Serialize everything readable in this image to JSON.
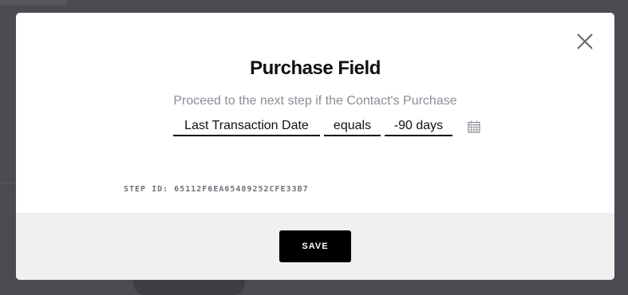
{
  "modal": {
    "title": "Purchase Field",
    "subtitle": "Proceed to the next step if the Contact's Purchase",
    "close_icon": "close-icon",
    "fields": {
      "property": "Last Transaction Date",
      "operator": "equals",
      "value": "-90 days"
    },
    "calendar_icon": "calendar-icon",
    "step_id": "STEP ID: 65112F6EA65489252CFE33B7",
    "save_label": "SAVE"
  },
  "colors": {
    "overlay": "#4a4c52",
    "button": "#000000",
    "footer": "#f0f0f0",
    "subtitle": "#8a8f96"
  }
}
